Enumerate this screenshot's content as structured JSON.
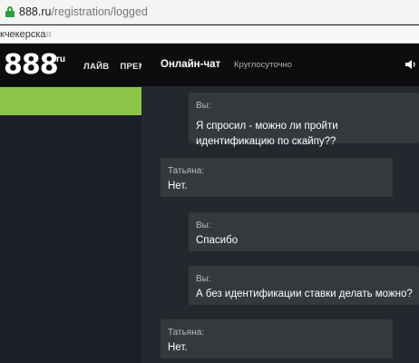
{
  "browser": {
    "url_host": "888.ru",
    "url_path": "/registration/logged",
    "bookmark_text": "кчекерска",
    "bookmark_fade": "я"
  },
  "site": {
    "logo_digits": "888",
    "logo_sup": "ru",
    "nav": [
      "ЛАЙВ",
      "ПРЕМ"
    ],
    "accent_color": "#8cc448"
  },
  "chat": {
    "title": "Онлайн-чат",
    "subtitle": "Круглосуточно",
    "messages": [
      {
        "author": "Вы:",
        "lines": [
          "Я спросил - можно ли пройти",
          "идентификацию по скайпу??"
        ]
      },
      {
        "author": "Татьяна:",
        "lines": [
          "Нет."
        ]
      },
      {
        "author": "Вы:",
        "lines": [
          "Спасибо"
        ]
      },
      {
        "author": "Вы:",
        "lines": [
          "А без идентификации ставки делать можно?"
        ]
      },
      {
        "author": "Татьяна:",
        "lines": [
          "Нет."
        ]
      }
    ]
  }
}
